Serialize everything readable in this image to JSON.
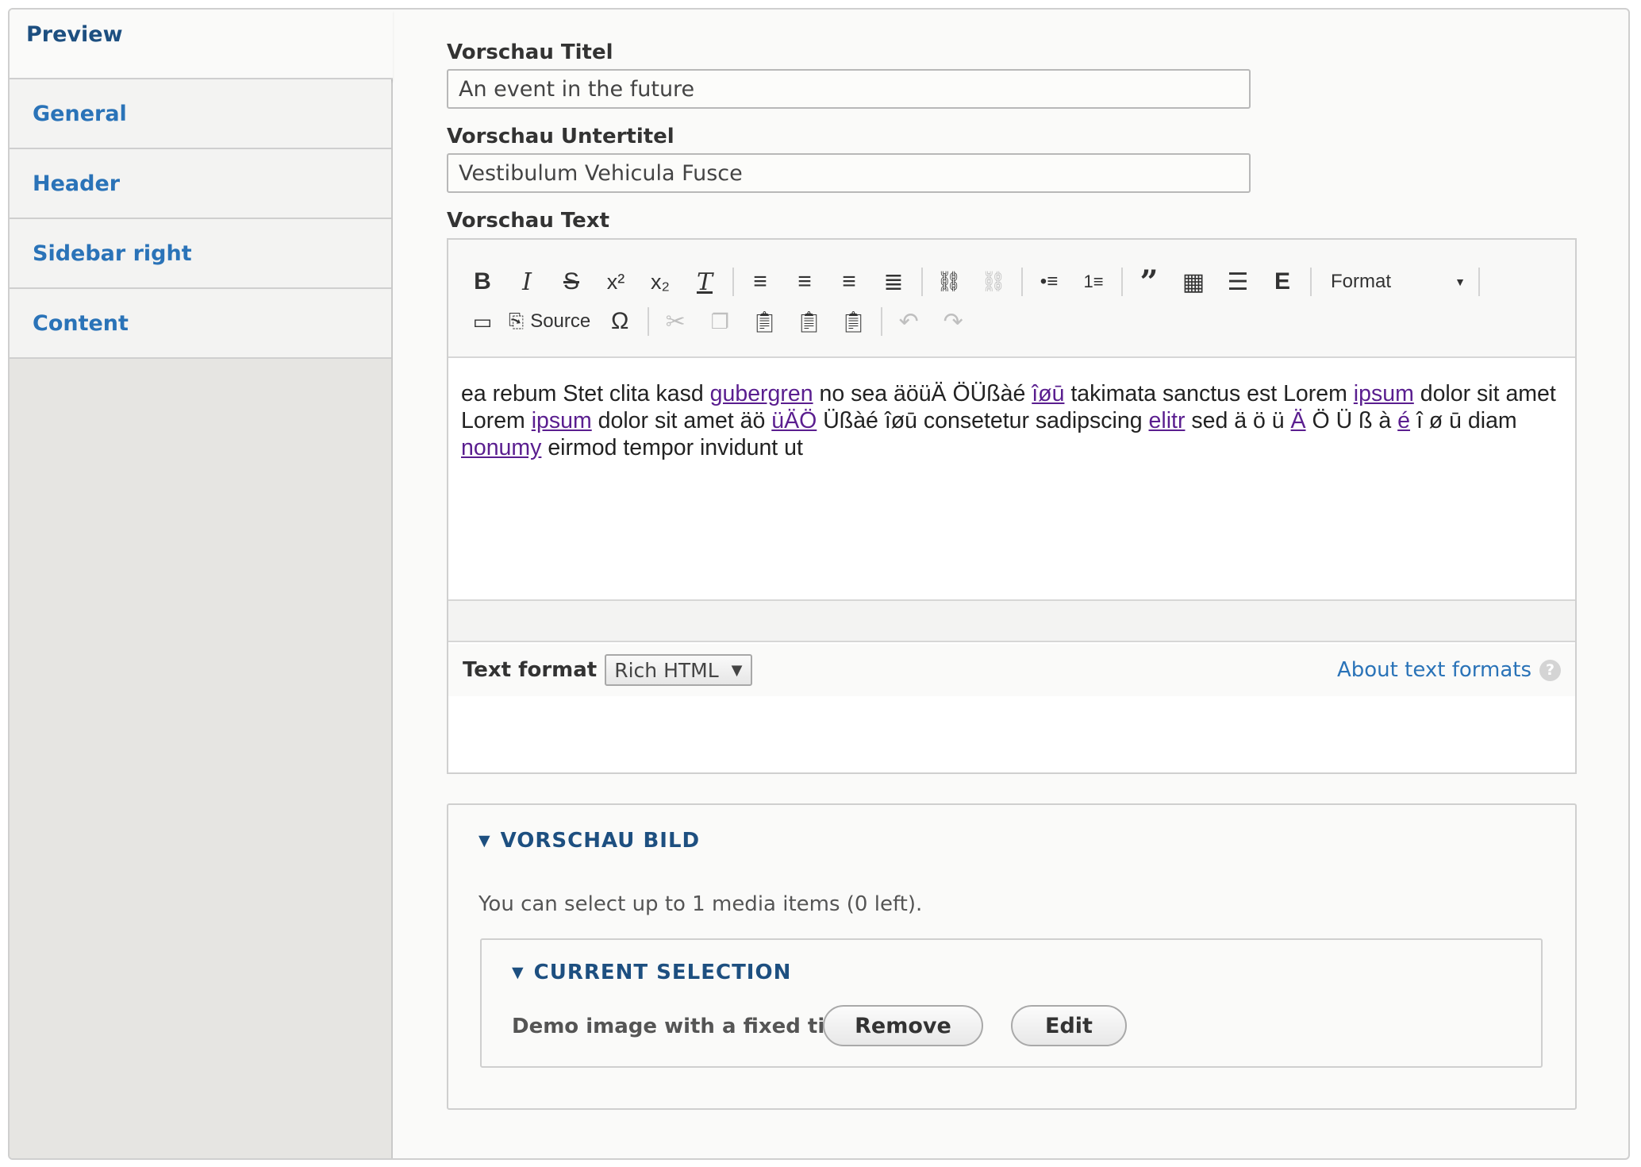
{
  "tabs": [
    {
      "label": "Preview",
      "active": true
    },
    {
      "label": "General"
    },
    {
      "label": "Header"
    },
    {
      "label": "Sidebar right"
    },
    {
      "label": "Content"
    }
  ],
  "fields": {
    "title_label": "Vorschau Titel",
    "title_value": "An event in the future",
    "subtitle_label": "Vorschau Untertitel",
    "subtitle_value": "Vestibulum Vehicula Fusce",
    "text_label": "Vorschau Text"
  },
  "toolbar": {
    "format_label": "Format",
    "source_label": "Source"
  },
  "editor": {
    "segments": [
      {
        "t": "ea rebum Stet clita kasd "
      },
      {
        "t": "gubergren",
        "link": true
      },
      {
        "t": " no sea äöüÄ ÖÜßàé "
      },
      {
        "t": "îøū",
        "link": true
      },
      {
        "t": " takimata sanctus est Lorem "
      },
      {
        "t": "ipsum",
        "link": true
      },
      {
        "t": " dolor sit amet Lorem "
      },
      {
        "t": "ipsum",
        "link": true
      },
      {
        "t": " dolor sit amet äö "
      },
      {
        "t": "üÄÖ",
        "link": true
      },
      {
        "t": " Üßàé îøū consetetur sadipscing "
      },
      {
        "t": "elitr",
        "link": true
      },
      {
        "t": " sed ä ö ü "
      },
      {
        "t": "Ä",
        "link": true
      },
      {
        "t": " Ö Ü ß à "
      },
      {
        "t": "é",
        "link": true
      },
      {
        "t": " î ø ū diam "
      },
      {
        "t": "nonumy",
        "link": true
      },
      {
        "t": " eirmod tempor invidunt ut"
      }
    ]
  },
  "text_format": {
    "label": "Text format",
    "selected": "Rich HTML",
    "about_link": "About text formats",
    "help_glyph": "?"
  },
  "media": {
    "legend": "VORSCHAU BILD",
    "description": "You can select up to 1 media items (0 left).",
    "selection_legend": "CURRENT SELECTION",
    "item_title": "Demo image with a fixed title",
    "remove_label": "Remove",
    "edit_label": "Edit"
  }
}
